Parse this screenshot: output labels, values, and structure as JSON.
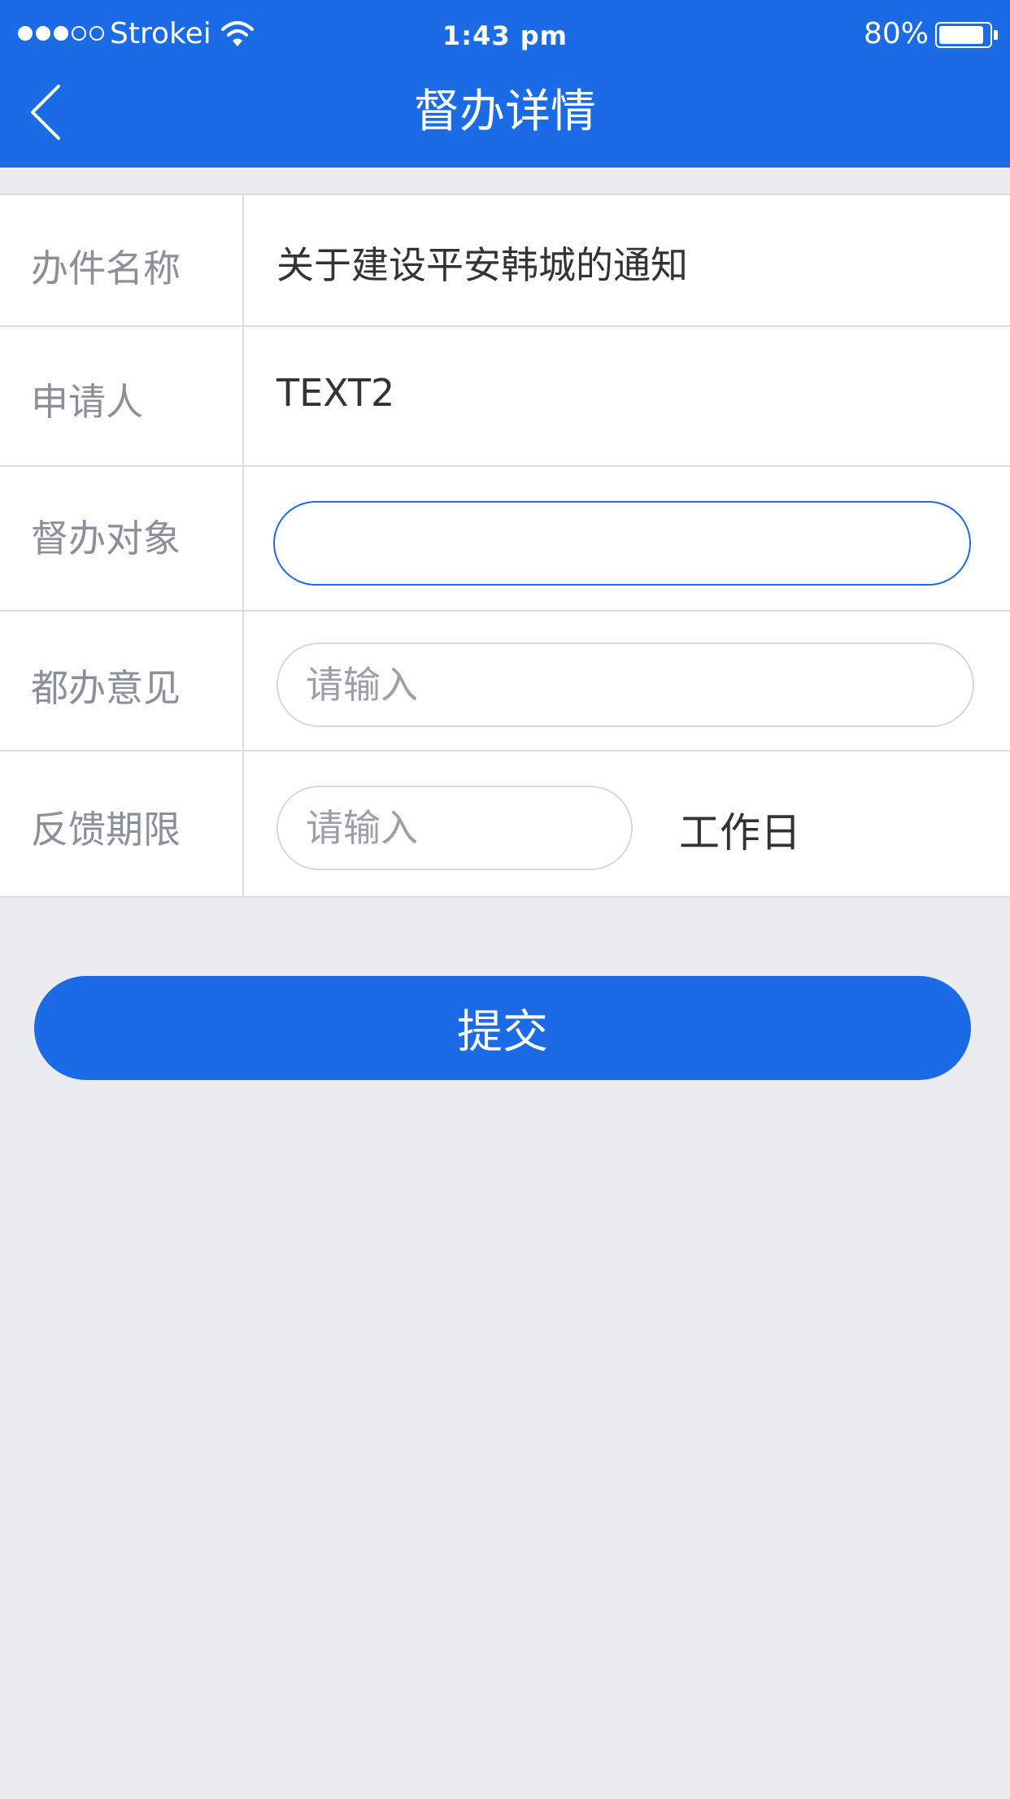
{
  "status_bar": {
    "carrier": "Strokei",
    "time": "1:43  pm",
    "battery_percent": "80%",
    "battery_level": 0.9,
    "signal_strength": 3,
    "signal_max": 5
  },
  "nav": {
    "title": "督办详情",
    "back_icon": "chevron-left-icon"
  },
  "form": {
    "rows": [
      {
        "label": "办件名称",
        "value": "关于建设平安韩城的通知"
      },
      {
        "label": "申请人",
        "value": "TEXT2"
      },
      {
        "label": "督办对象",
        "input_value": "",
        "placeholder": ""
      },
      {
        "label": "都办意见",
        "input_value": "",
        "placeholder": "请输入"
      },
      {
        "label": "反馈期限",
        "input_value": "",
        "placeholder": "请输入",
        "unit": "工作日"
      }
    ]
  },
  "submit_label": "提交",
  "colors": {
    "primary": "#1A6BE5",
    "background": "#EAECF0",
    "label": "#8A8F99",
    "text": "#333333",
    "border": "#DADDE2"
  }
}
